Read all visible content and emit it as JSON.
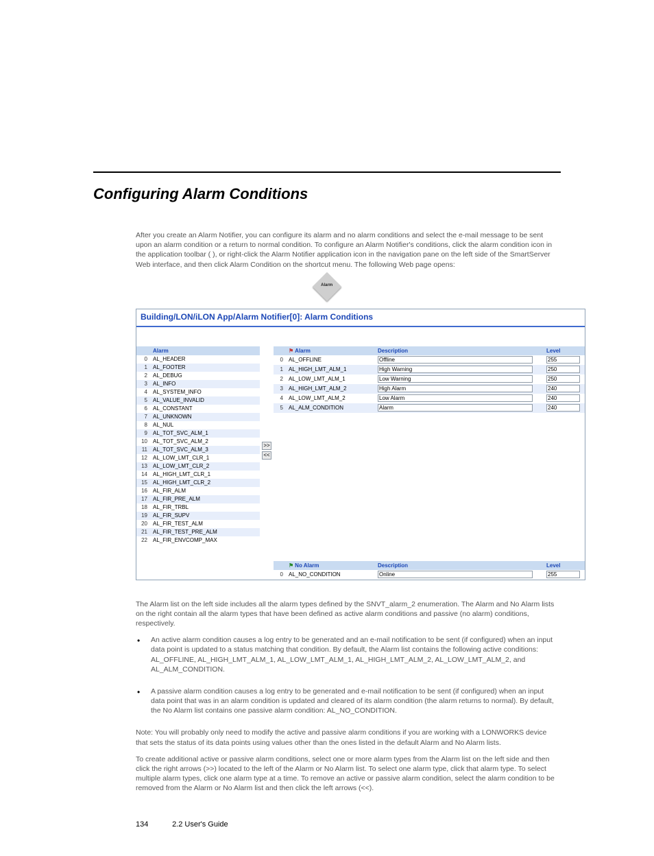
{
  "section_title": "Configuring Alarm Conditions",
  "intro": "After you create an Alarm Notifier, you can configure its alarm and no alarm conditions and select the e-mail message to be sent upon an alarm condition or a return to normal condition. To configure an Alarm Notifier's conditions, click the alarm condition icon in the application toolbar (      ), or right-click the Alarm Notifier application icon in the navigation pane on the left side of the SmartServer Web interface, and then click Alarm Condition on the shortcut menu. The following Web page opens:",
  "diamond_label": "Alarm",
  "shot_title": "Building/LON/iLON App/Alarm Notifier[0]: Alarm Conditions",
  "left_header": "Alarm",
  "left_rows": [
    "AL_HEADER",
    "AL_FOOTER",
    "AL_DEBUG",
    "AL_INFO",
    "AL_SYSTEM_INFO",
    "AL_VALUE_INVALID",
    "AL_CONSTANT",
    "AL_UNKNOWN",
    "AL_NUL",
    "AL_TOT_SVC_ALM_1",
    "AL_TOT_SVC_ALM_2",
    "AL_TOT_SVC_ALM_3",
    "AL_LOW_LMT_CLR_1",
    "AL_LOW_LMT_CLR_2",
    "AL_HIGH_LMT_CLR_1",
    "AL_HIGH_LMT_CLR_2",
    "AL_FIR_ALM",
    "AL_FIR_PRE_ALM",
    "AL_FIR_TRBL",
    "AL_FIR_SUPV",
    "AL_FIR_TEST_ALM",
    "AL_FIR_TEST_PRE_ALM",
    "AL_FIR_ENVCOMP_MAX"
  ],
  "btn_right": ">>",
  "btn_left": "<<",
  "alarm_header": {
    "alarm": "Alarm",
    "desc": "Description",
    "level": "Level"
  },
  "alarm_rows": [
    {
      "a": "AL_OFFLINE",
      "d": "Offline",
      "l": "255"
    },
    {
      "a": "AL_HIGH_LMT_ALM_1",
      "d": "High Warning",
      "l": "250"
    },
    {
      "a": "AL_LOW_LMT_ALM_1",
      "d": "Low Warning",
      "l": "250"
    },
    {
      "a": "AL_HIGH_LMT_ALM_2",
      "d": "High Alarm",
      "l": "240"
    },
    {
      "a": "AL_LOW_LMT_ALM_2",
      "d": "Low Alarm",
      "l": "240"
    },
    {
      "a": "AL_ALM_CONDITION",
      "d": "Alarm",
      "l": "240"
    }
  ],
  "noalarm_header": {
    "alarm": "No Alarm",
    "desc": "Description",
    "level": "Level"
  },
  "noalarm_rows": [
    {
      "a": "AL_NO_CONDITION",
      "d": "Online",
      "l": "255"
    }
  ],
  "post_text": "The Alarm list on the left side includes all the alarm types defined by the SNVT_alarm_2 enumeration. The Alarm and No Alarm lists on the right contain all the alarm types that have been defined as active alarm conditions and passive (no alarm) conditions, respectively.",
  "bullets": [
    "An active alarm condition causes a log entry to be generated and an e-mail notification to be sent (if configured) when an input data point is updated to a status matching that condition. By default, the Alarm list contains the following active conditions: AL_OFFLINE, AL_HIGH_LMT_ALM_1, AL_LOW_LMT_ALM_1, AL_HIGH_LMT_ALM_2, AL_LOW_LMT_ALM_2, and AL_ALM_CONDITION.",
    "A passive alarm condition causes a log entry to be generated and e-mail notification to be sent (if configured) when an input data point that was in an alarm condition is updated and cleared of its alarm condition (the alarm returns to normal). By default, the No Alarm list contains one passive alarm condition: AL_NO_CONDITION."
  ],
  "post_bullets_1": "Note: You will probably only need to modify the active and passive alarm conditions if you are working with a LONWORKS device that sets the status of its data points using values other than the ones listed in the default Alarm and No Alarm lists.",
  "post_bullets_2": "To create additional active or passive alarm conditions, select one or more alarm types from the Alarm list on the left side and then click the right arrows (>>) located to the left of the Alarm or No Alarm list. To select one alarm type, click that alarm type. To select multiple alarm types, click one alarm type at a time. To remove an active or passive alarm condition, select the alarm condition to be removed from the Alarm or No Alarm list and then click the left arrows (<<).",
  "footer_page": "134",
  "footer_text": "2.2 User's Guide"
}
